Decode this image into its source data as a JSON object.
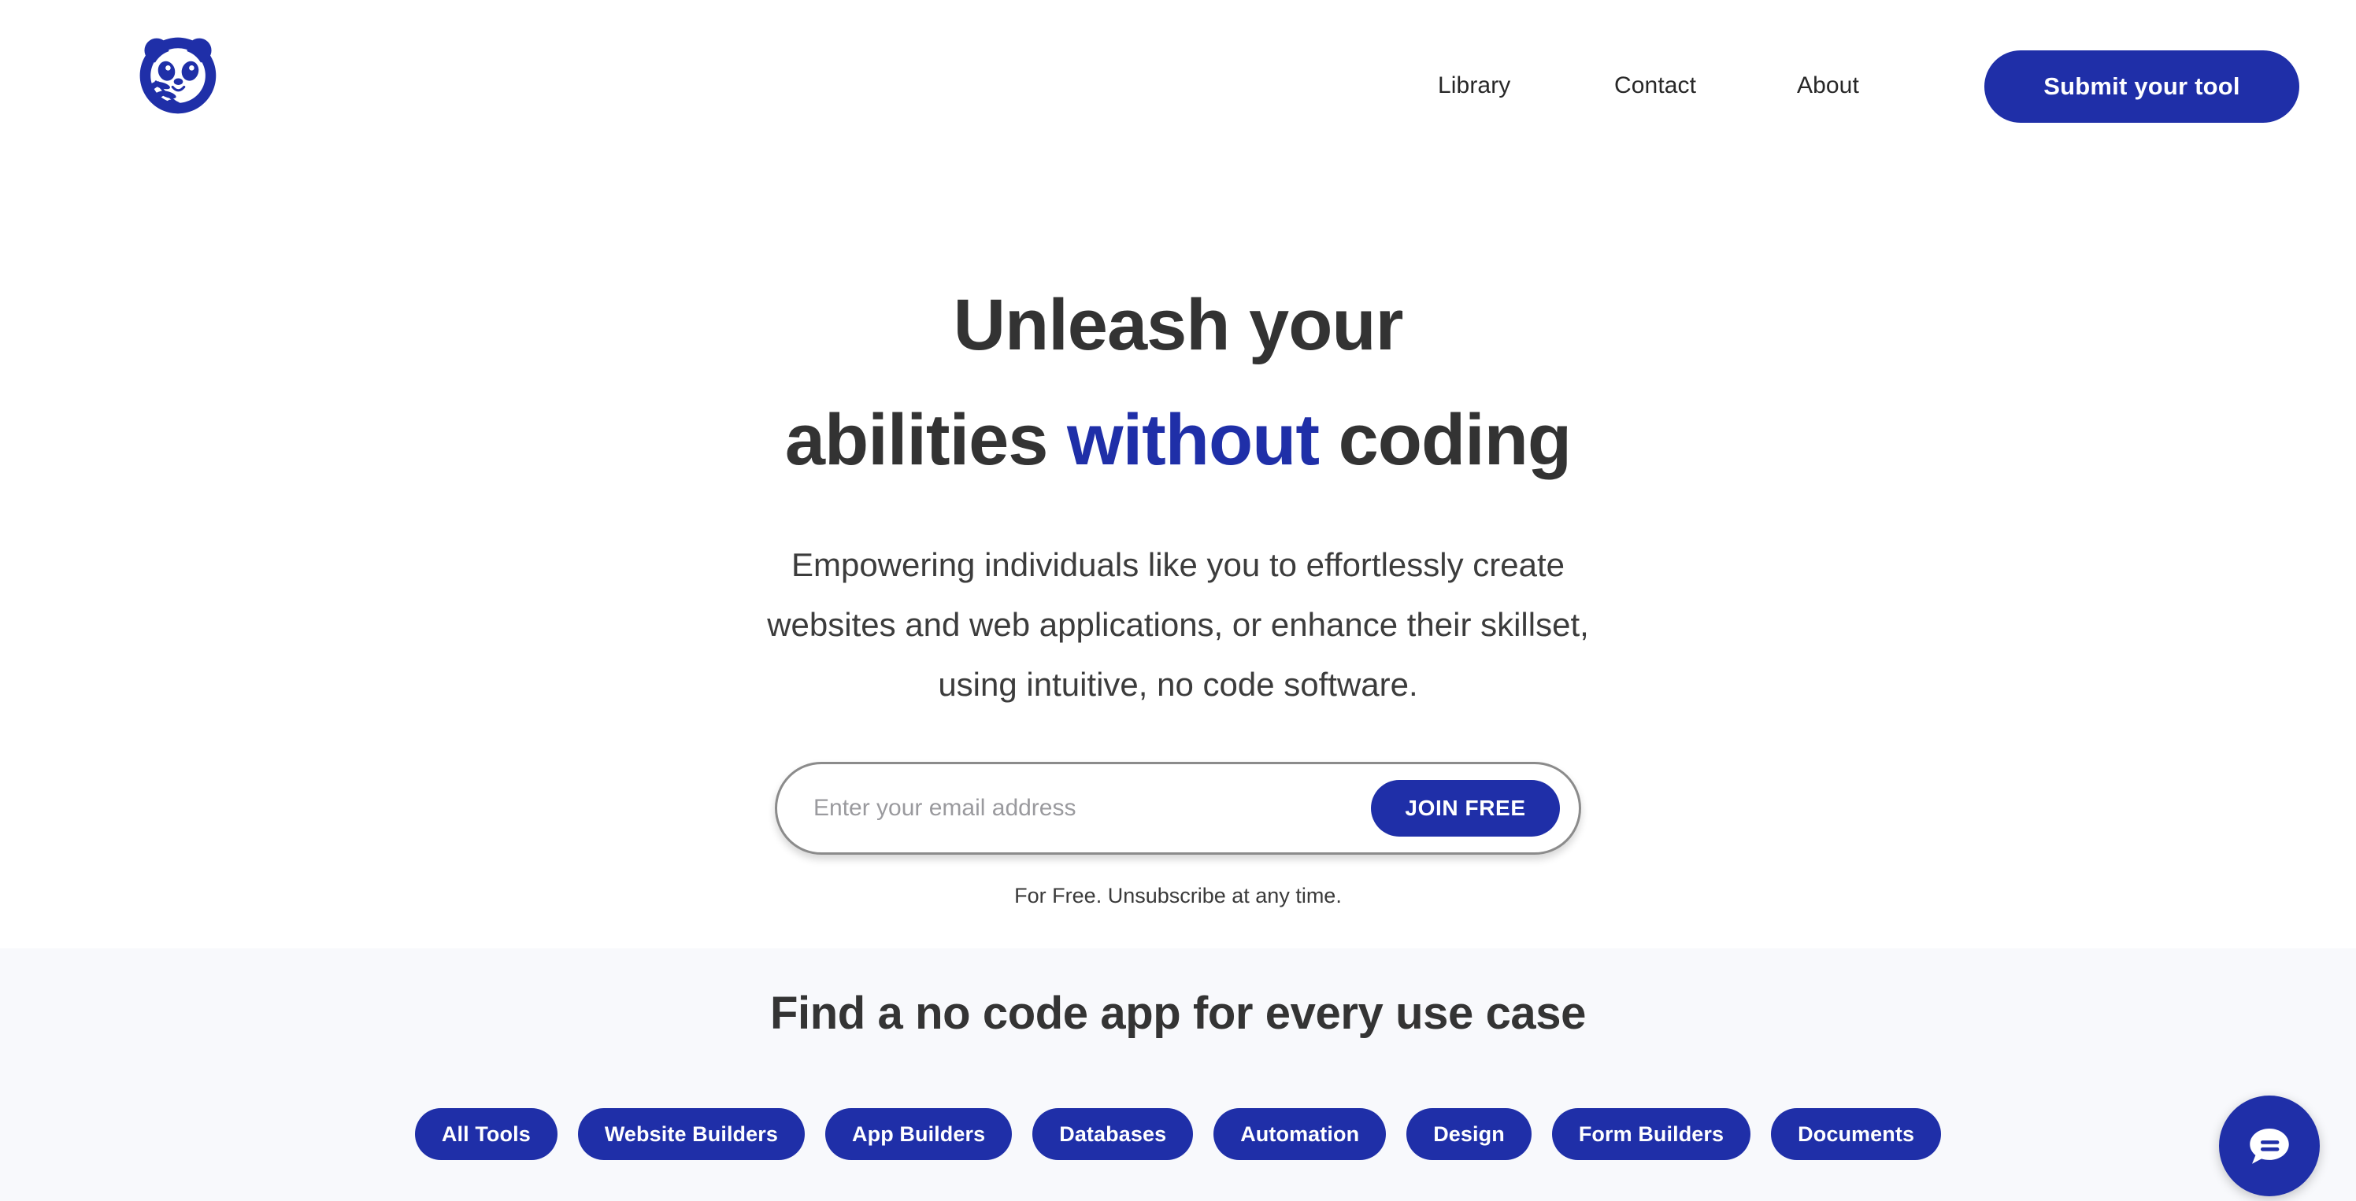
{
  "brand": {
    "logo_icon": "panda-logo-icon",
    "accent_color": "#1f2fa8",
    "section_bg_color": "#f8f9fc"
  },
  "header": {
    "nav": [
      {
        "label": "Library"
      },
      {
        "label": "Contact"
      },
      {
        "label": "About"
      }
    ],
    "cta": {
      "label": "Submit your tool"
    }
  },
  "hero": {
    "title_line1": "Unleash your",
    "title_line2_pre": "abilities ",
    "title_line2_accent": "without",
    "title_line2_post": " coding",
    "subtitle_line1": "Empowering individuals like you to effortlessly create",
    "subtitle_line2": "websites and web applications, or enhance their skillset,",
    "subtitle_line3": "using intuitive, no code software.",
    "form": {
      "email_placeholder": "Enter your email address",
      "email_value": "",
      "submit_label": "JOIN FREE",
      "note": "For Free. Unsubscribe at any time."
    }
  },
  "usecase": {
    "title": "Find a no code app for every use case",
    "pills": [
      {
        "label": "All Tools"
      },
      {
        "label": "Website Builders"
      },
      {
        "label": "App Builders"
      },
      {
        "label": "Databases"
      },
      {
        "label": "Automation"
      },
      {
        "label": "Design"
      },
      {
        "label": "Form Builders"
      },
      {
        "label": "Documents"
      }
    ]
  },
  "chat": {
    "icon": "chat-bubble-icon"
  }
}
